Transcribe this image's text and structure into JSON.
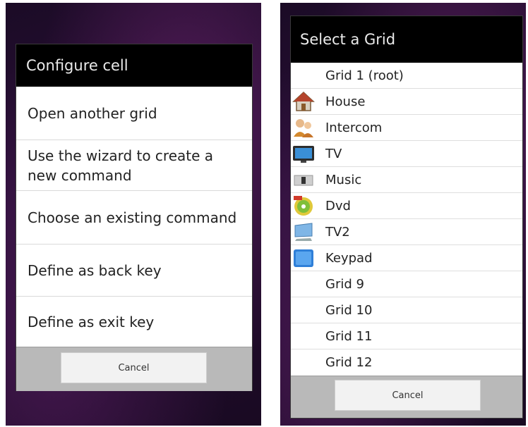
{
  "configure_dialog": {
    "title": "Configure cell",
    "items": [
      {
        "label": "Open another grid"
      },
      {
        "label": "Use the wizard to create a new command"
      },
      {
        "label": "Choose an existing command"
      },
      {
        "label": "Define as back key"
      },
      {
        "label": "Define as exit key"
      }
    ],
    "cancel_label": "Cancel"
  },
  "select_grid_dialog": {
    "title": "Select a Grid",
    "items": [
      {
        "label": "Grid 1 (root)",
        "icon": ""
      },
      {
        "label": "House",
        "icon": "house-icon"
      },
      {
        "label": "Intercom",
        "icon": "people-icon"
      },
      {
        "label": "TV",
        "icon": "tv-icon"
      },
      {
        "label": "Music",
        "icon": "speaker-icon"
      },
      {
        "label": "Dvd",
        "icon": "dvd-disc-icon"
      },
      {
        "label": "TV2",
        "icon": "monitor-icon"
      },
      {
        "label": "Keypad",
        "icon": "keypad-icon"
      },
      {
        "label": "Grid 9",
        "icon": ""
      },
      {
        "label": "Grid 10",
        "icon": ""
      },
      {
        "label": "Grid 11",
        "icon": ""
      },
      {
        "label": "Grid 12",
        "icon": ""
      }
    ],
    "cancel_label": "Cancel"
  }
}
